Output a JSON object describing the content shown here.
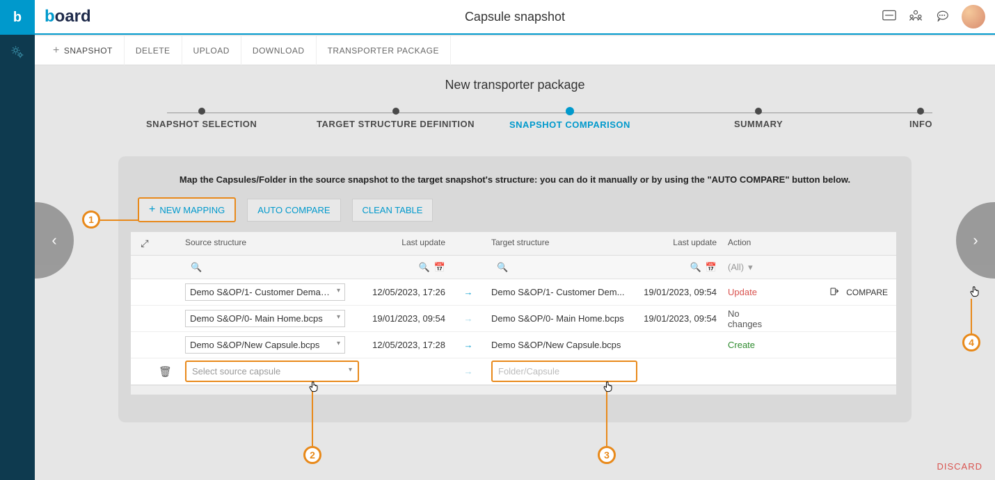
{
  "header": {
    "page_title": "Capsule snapshot",
    "logo_colored": "b",
    "logo_rest": "oard"
  },
  "toolbar": {
    "snapshot": "SNAPSHOT",
    "delete": "DELETE",
    "upload": "UPLOAD",
    "download": "DOWNLOAD",
    "transporter": "TRANSPORTER PACKAGE"
  },
  "wizard": {
    "title": "New transporter package",
    "steps": {
      "s1": "SNAPSHOT SELECTION",
      "s2": "TARGET STRUCTURE DEFINITION",
      "s3": "SNAPSHOT COMPARISON",
      "s4": "SUMMARY",
      "s5": "INFO"
    },
    "desc": "Map the Capsules/Folder in the source snapshot to the target snapshot's structure: you can do it manually or by using the \"AUTO COMPARE\" button below."
  },
  "buttons": {
    "new_mapping": "NEW MAPPING",
    "auto_compare": "AUTO COMPARE",
    "clean_table": "CLEAN TABLE"
  },
  "table": {
    "headers": {
      "source": "Source structure",
      "source_update": "Last update",
      "target": "Target structure",
      "target_update": "Last update",
      "action": "Action"
    },
    "filter_all": "(All)",
    "rows": [
      {
        "source": "Demo S&OP/1- Customer Deman...",
        "source_update": "12/05/2023, 17:26",
        "target": "Demo S&OP/1- Customer Dem...",
        "target_update": "19/01/2023, 09:54",
        "action": "Update",
        "action_class": "act-update",
        "compare": true
      },
      {
        "source": "Demo S&OP/0- Main Home.bcps",
        "source_update": "19/01/2023, 09:54",
        "target": "Demo S&OP/0- Main Home.bcps",
        "target_update": "19/01/2023, 09:54",
        "action": "No changes",
        "action_class": "act-none",
        "compare": false
      },
      {
        "source": "Demo S&OP/New Capsule.bcps",
        "source_update": "12/05/2023, 17:28",
        "target": "Demo S&OP/New Capsule.bcps",
        "target_update": "",
        "action": "Create",
        "action_class": "act-create",
        "compare": false
      }
    ],
    "new_row": {
      "source_placeholder": "Select source capsule",
      "target_placeholder": "Folder/Capsule"
    },
    "compare_label": "COMPARE"
  },
  "footer": {
    "discard": "DISCARD"
  },
  "callouts": {
    "c1": "1",
    "c2": "2",
    "c3": "3",
    "c4": "4"
  }
}
